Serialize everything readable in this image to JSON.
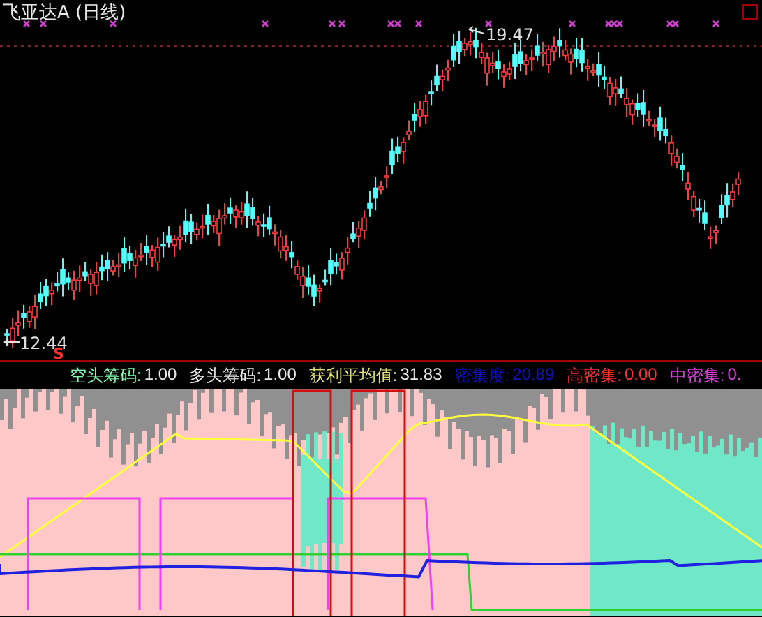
{
  "title": "飞亚达A (日线)",
  "price_labels": {
    "high": "19.47",
    "low": "12.44",
    "signal": "S"
  },
  "legend": [
    {
      "label": "空头筹码:",
      "value": "1.00",
      "color": "#80ffb0",
      "kind": "split"
    },
    {
      "label": "多头筹码:",
      "value": "1.00",
      "color": "#e8e8e8",
      "kind": "split"
    },
    {
      "label": "获利平均值:",
      "value": "31.83",
      "color": "#e0e070",
      "kind": "split"
    },
    {
      "label": "密集度:",
      "value": "20.89",
      "color": "#1010c0",
      "kind": "solid"
    },
    {
      "label": "高密集:",
      "value": "0.00",
      "color": "#ff3030",
      "kind": "solid"
    },
    {
      "label": "中密集:",
      "value": "0.",
      "color": "#e040e0",
      "kind": "solid"
    }
  ]
}
